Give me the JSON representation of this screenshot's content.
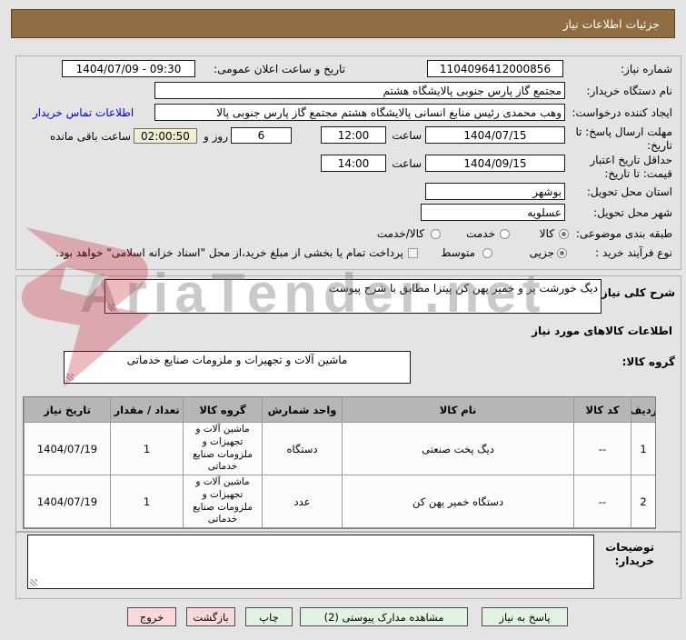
{
  "title": "جزئیات اطلاعات نیاز",
  "watermark": {
    "text": "AriaTender.net"
  },
  "fields": {
    "need_number": {
      "label": "شماره نیاز:",
      "value": "1104096412000856"
    },
    "announce": {
      "label": "تاریخ و ساعت اعلان عمومی:",
      "value": "1404/07/09 - 09:30"
    },
    "buyer_org": {
      "label": "نام دستگاه خریدار:",
      "value": "مجتمع گاز پارس جنوبی  پالایشگاه هشتم"
    },
    "creator": {
      "label": "ایجاد کننده درخواست:",
      "value": "وهب محمدی رئیس منابع انسانی پالایشگاه هشتم مجتمع گاز پارس جنوبی  پالا",
      "link": "اطلاعات تماس خریدار"
    },
    "deadline": {
      "label": "مهلت ارسال پاسخ: تا تاریخ:",
      "date": "1404/07/15",
      "hour_label": "ساعت",
      "time": "12:00"
    },
    "countdown": {
      "days": "6",
      "days_label": "روز و",
      "time": "02:00:50",
      "remain_label": "ساعت باقی مانده"
    },
    "validity": {
      "label": "حداقل تاریخ اعتبار قیمت: تا تاریخ:",
      "date": "1404/09/15",
      "hour_label": "ساعت",
      "time": "14:00"
    },
    "province": {
      "label": "استان محل تحویل:",
      "value": "بوشهر"
    },
    "city": {
      "label": "شهر محل تحویل:",
      "value": "عسلویه"
    }
  },
  "classification": {
    "label": "طبقه بندی موضوعی:",
    "options": [
      "کالا",
      "خدمت",
      "کالا/خدمت"
    ],
    "selected": "کالا"
  },
  "process": {
    "label": "نوع فرآیند خرید :",
    "options": [
      "جزیی",
      "متوسط"
    ],
    "selected": "جزیی",
    "note": "پرداخت تمام یا بخشی از مبلغ خرید،از محل \"اسناد خزانه اسلامی\" خواهد بود."
  },
  "need_desc": {
    "label": "شرح کلی نیاز:",
    "value": "دیگ خورشت پز و خمیر پهن کن پیتزا مطابق با شرح پیوست"
  },
  "goods": {
    "header": "اطلاعات کالاهای مورد نیاز",
    "group_label": "گروه کالا:",
    "group_value": "ماشین آلات و تجهیزات و ملزومات صنایع خدماتی"
  },
  "table": {
    "headers": [
      "ردیف",
      "کد کالا",
      "نام کالا",
      "واحد شمارش",
      "گروه کالا",
      "تعداد / مقدار",
      "تاریخ نیاز"
    ],
    "rows": [
      [
        "1",
        "--",
        "دیگ پخت صنعتی",
        "دستگاه",
        "ماشین آلات و تجهیزات و ملزومات صنایع خدماتی",
        "1",
        "1404/07/19"
      ],
      [
        "2",
        "--",
        "دستگاه خمیر پهن کن",
        "عدد",
        "ماشین آلات و تجهیزات و ملزومات صنایع خدماتی",
        "1",
        "1404/07/19"
      ]
    ]
  },
  "comments": {
    "label": "توضیحات خریدار:"
  },
  "buttons": {
    "reply": "پاسخ به نیاز",
    "docs": "مشاهده مدارک پیوستی (2)",
    "print": "چاپ",
    "back": "بازگشت",
    "exit": "خروج"
  },
  "colors": {
    "titlebar": "#8f6c42",
    "button_green": "#e2f2e2",
    "button_pink": "#f9d9d9",
    "countdown_bg": "#f2edd0"
  }
}
